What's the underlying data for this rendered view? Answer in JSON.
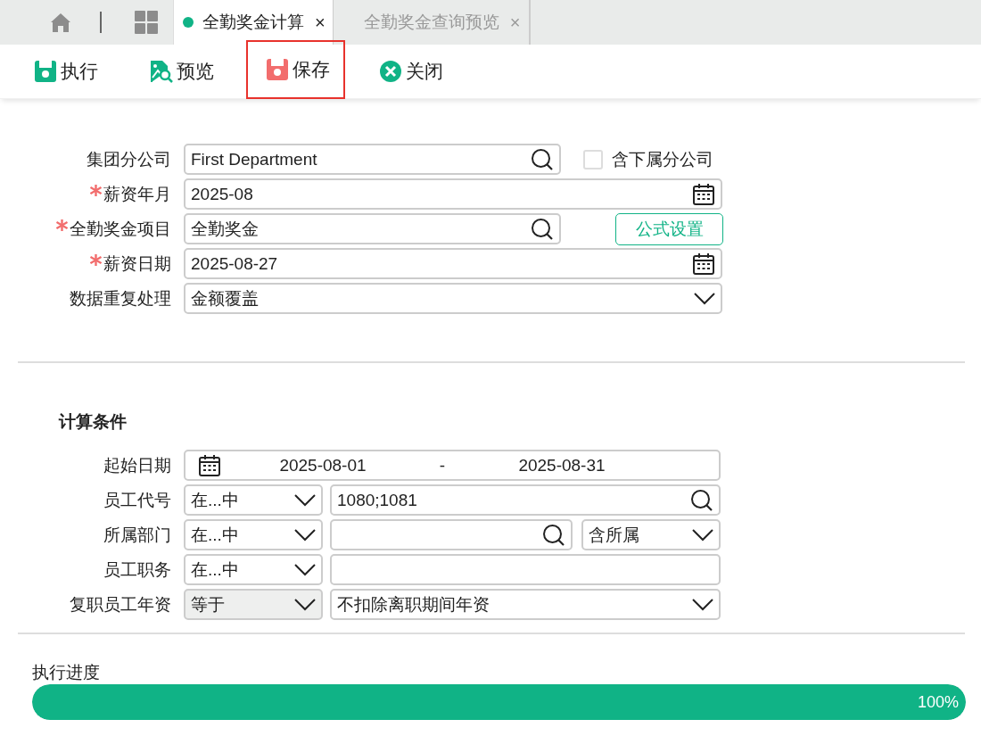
{
  "tabs": [
    {
      "kind": "home",
      "selected": false
    },
    {
      "kind": "apps",
      "selected": false
    },
    {
      "kind": "page",
      "label": "全勤奖金计算",
      "selected": true,
      "close": "×"
    },
    {
      "kind": "page",
      "label": "全勤奖金查询预览",
      "selected": false,
      "close": "×"
    }
  ],
  "toolbar": [
    {
      "kind": "execute",
      "label": "执行",
      "highlighted": false
    },
    {
      "kind": "preview",
      "label": "预览",
      "highlighted": false
    },
    {
      "kind": "save",
      "label": "保存",
      "highlighted": true
    },
    {
      "kind": "close",
      "label": "关闭",
      "highlighted": false
    }
  ],
  "form": [
    {
      "label": "集团分公司",
      "required": false,
      "kind": "lookup",
      "value": "First Department",
      "extra": {
        "kind": "checkbox",
        "label": "含下属分公司",
        "checked": false
      }
    },
    {
      "label": "薪资年月",
      "required": true,
      "kind": "date",
      "value": "2025-08"
    },
    {
      "label": "全勤奖金项目",
      "required": true,
      "kind": "lookup",
      "value": "全勤奖金",
      "extra": {
        "kind": "button",
        "label": "公式设置"
      }
    },
    {
      "label": "薪资日期",
      "required": true,
      "kind": "date",
      "value": "2025-08-27"
    },
    {
      "label": "数据重复处理",
      "required": false,
      "kind": "select",
      "value": "金额覆盖"
    }
  ],
  "conditions": {
    "title": "计算条件",
    "rows": [
      {
        "label": "起始日期",
        "kind": "daterange",
        "from": "2025-08-01",
        "separator": "-",
        "to": "2025-08-31"
      },
      {
        "label": "员工代号",
        "kind": "filter",
        "operator": {
          "value": "在...中",
          "disabled": false
        },
        "field": {
          "kind": "lookup",
          "value": "1080;1081"
        }
      },
      {
        "label": "所属部门",
        "kind": "filter",
        "operator": {
          "value": "在...中",
          "disabled": false
        },
        "field": {
          "kind": "lookup"
        },
        "scope": {
          "value": "含所属"
        }
      },
      {
        "label": "员工职务",
        "kind": "filter",
        "operator": {
          "value": "在...中",
          "disabled": false
        },
        "field": {
          "kind": "text"
        }
      },
      {
        "label": "复职员工年资",
        "kind": "filter",
        "operator": {
          "value": "等于",
          "disabled": true
        },
        "field": {
          "kind": "select",
          "value": "不扣除离职期间年资"
        }
      }
    ]
  },
  "progress": {
    "label": "执行进度",
    "level": 1,
    "reading": "100%"
  }
}
